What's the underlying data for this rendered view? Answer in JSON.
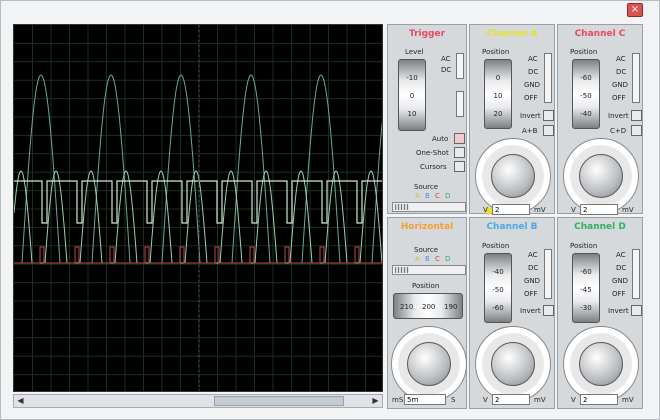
{
  "window": {
    "close_label": "×"
  },
  "trigger": {
    "title": "Trigger",
    "level_label": "Level",
    "ac": "AC",
    "dc": "DC",
    "drum": [
      "-10",
      "0",
      "10"
    ],
    "auto": "Auto",
    "one_shot": "One-Shot",
    "cursors": "Cursors",
    "source": "Source",
    "sources": [
      "A",
      "B",
      "C",
      "D"
    ]
  },
  "channel_a": {
    "title": "Channel A",
    "position": "Position",
    "drum": [
      "0",
      "10",
      "20"
    ],
    "modes": [
      "AC",
      "DC",
      "GND",
      "OFF"
    ],
    "invert": "Invert",
    "combo": "A+B",
    "units": [
      "V",
      "mV"
    ],
    "value": "2"
  },
  "channel_b": {
    "title": "Channel B",
    "position": "Position",
    "drum": [
      "-40",
      "-50",
      "-60"
    ],
    "modes": [
      "AC",
      "DC",
      "GND",
      "OFF"
    ],
    "invert": "Invert",
    "units": [
      "V",
      "mV"
    ],
    "value": "2"
  },
  "channel_c": {
    "title": "Channel C",
    "position": "Position",
    "drum": [
      "-60",
      "-50",
      "-40"
    ],
    "modes": [
      "AC",
      "DC",
      "GND",
      "OFF"
    ],
    "invert": "Invert",
    "combo": "C+D",
    "units": [
      "V",
      "mV"
    ],
    "value": "2"
  },
  "channel_d": {
    "title": "Channel D",
    "position": "Position",
    "drum": [
      "-60",
      "-45",
      "-30"
    ],
    "modes": [
      "AC",
      "DC",
      "GND",
      "OFF"
    ],
    "invert": "Invert",
    "units": [
      "V",
      "mV"
    ],
    "value": "2"
  },
  "horizontal": {
    "title": "Horizontal",
    "source": "Source",
    "sources": [
      "A",
      "B",
      "C",
      "D"
    ],
    "position": "Position",
    "drum": [
      "210",
      "200",
      "190"
    ],
    "units": [
      "mS",
      "S"
    ],
    "value": "5m"
  },
  "colors": {
    "trace_a": "#e0e040",
    "trace_b": "#4aa8e8",
    "trace_c": "#e04050",
    "trace_d": "#40c070",
    "screen_bg": "#000000",
    "grid": "#1f3320",
    "panel": "#d6d9dc"
  }
}
